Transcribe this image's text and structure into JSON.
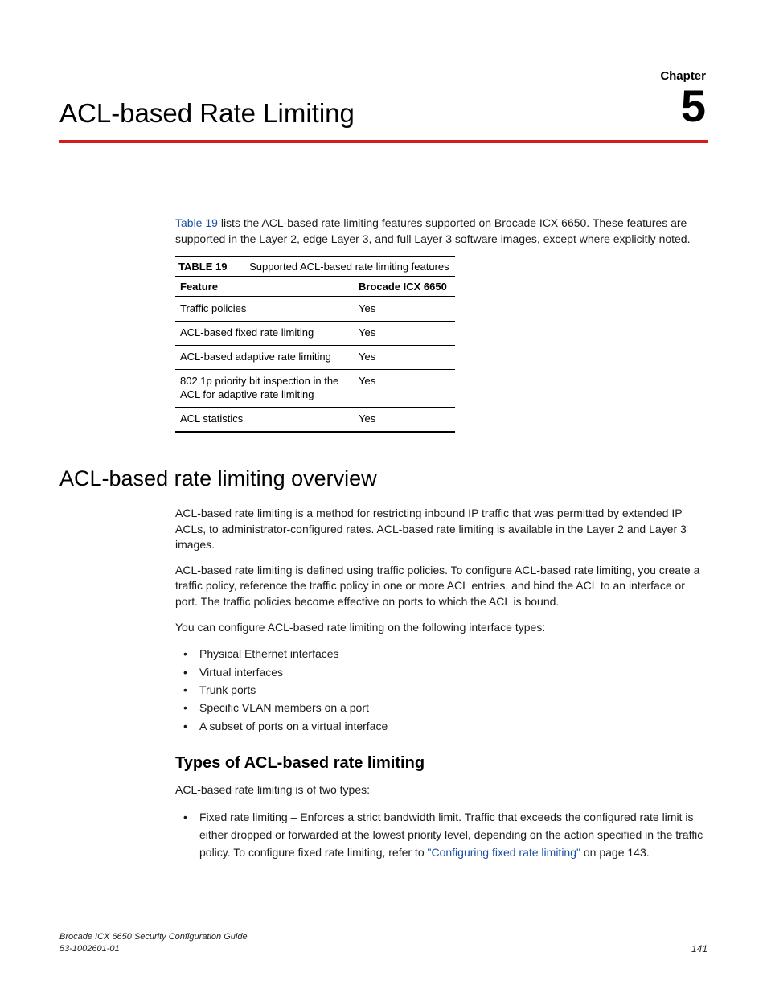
{
  "chapter": {
    "label": "Chapter",
    "number": "5",
    "title": "ACL-based Rate Limiting"
  },
  "intro": {
    "link_text": "Table 19",
    "rest": " lists the ACL-based rate limiting features supported on Brocade ICX 6650. These features are supported in the Layer 2, edge Layer 3, and full Layer 3 software images, except where explicitly noted."
  },
  "table": {
    "caption_label": "TABLE 19",
    "caption_text": "Supported ACL-based rate limiting features",
    "headers": [
      "Feature",
      "Brocade ICX 6650"
    ],
    "rows": [
      [
        "Traffic policies",
        "Yes"
      ],
      [
        "ACL-based fixed rate limiting",
        "Yes"
      ],
      [
        "ACL-based adaptive rate limiting",
        "Yes"
      ],
      [
        "802.1p priority bit inspection in the ACL for adaptive rate limiting",
        "Yes"
      ],
      [
        "ACL statistics",
        "Yes"
      ]
    ]
  },
  "overview": {
    "heading": "ACL-based rate limiting overview",
    "p1": "ACL-based rate limiting is a method for restricting inbound IP traffic that was permitted by extended IP ACLs, to administrator-configured rates. ACL-based rate limiting is available in the Layer 2 and Layer 3 images.",
    "p2": "ACL-based rate limiting is defined using traffic policies. To configure ACL-based rate limiting, you create a traffic policy, reference the traffic policy in one or more ACL entries, and bind the ACL to an interface or port. The traffic policies become effective on ports to which the ACL is bound.",
    "p3": "You can configure ACL-based rate limiting on the following interface types:",
    "bullets": [
      "Physical Ethernet interfaces",
      "Virtual interfaces",
      "Trunk ports",
      "Specific VLAN members on a port",
      "A subset of ports on a virtual interface"
    ],
    "types_heading": "Types of ACL-based rate limiting",
    "types_intro": "ACL-based rate limiting is of two types:",
    "types_bullets": {
      "0": {
        "pre": "Fixed rate limiting – Enforces a strict bandwidth limit. Traffic that exceeds the configured rate limit is either dropped or forwarded at the lowest priority level, depending on the action specified in the traffic policy. To configure fixed rate limiting, refer to ",
        "link": "\"Configuring fixed rate limiting\"",
        "post": " on page 143."
      }
    }
  },
  "footer": {
    "title": "Brocade ICX 6650 Security Configuration Guide",
    "docnum": "53-1002601-01",
    "page": "141"
  }
}
